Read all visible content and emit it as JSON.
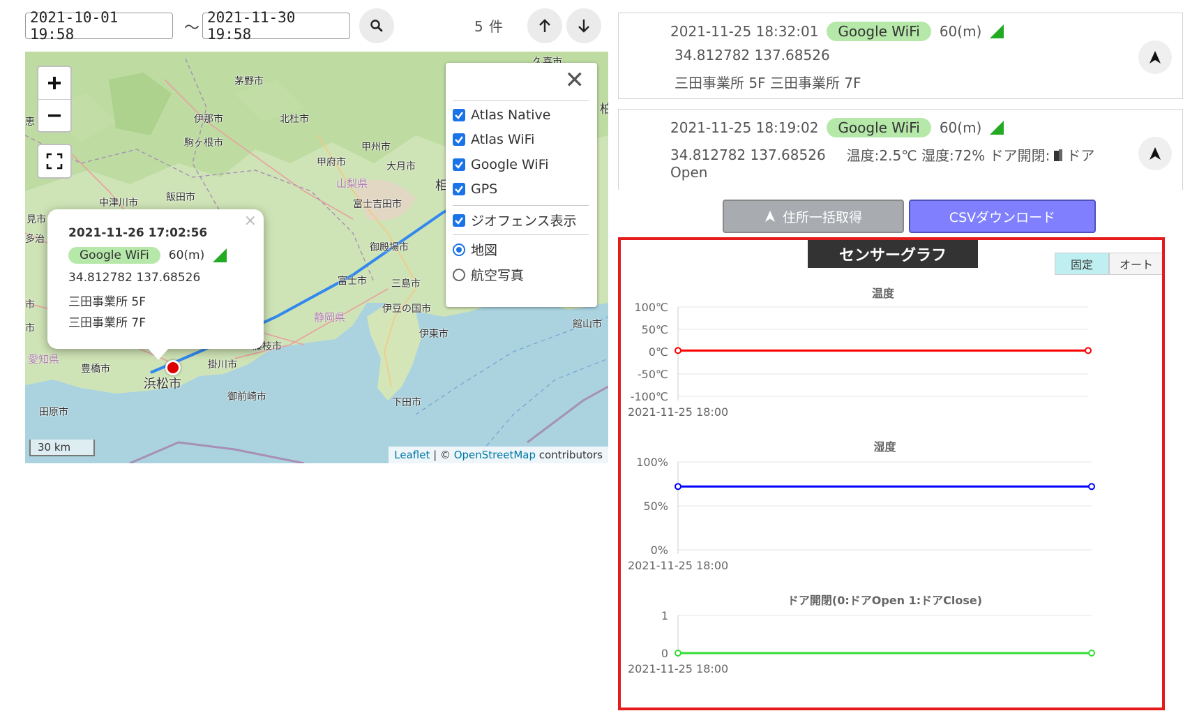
{
  "toolbar": {
    "date_from": "2021-10-01 19:58",
    "date_to": "2021-11-30 19:58",
    "separator": "〜",
    "count": "5 件"
  },
  "map": {
    "towns": [
      "茅野市",
      "伊那市",
      "北杜市",
      "駒ヶ根市",
      "甲州市",
      "甲府市",
      "大月市",
      "飯田市",
      "中津川市",
      "富士吉田市",
      "御殿場市",
      "富士市",
      "三島市",
      "伊豆の国市",
      "静岡県",
      "伊東市",
      "館山市",
      "藤枝市",
      "掛川市",
      "豊橋市",
      "浜松市",
      "御前崎市",
      "下田市",
      "田原市",
      "愛知県",
      "山梨県",
      "相",
      "柏",
      "見市",
      "多治",
      "市",
      "市",
      "恵",
      "久喜市"
    ],
    "scale_label": "30 km",
    "attribution": {
      "leaflet": "Leaflet",
      "sep": " | © ",
      "osm": "OpenStreetMap",
      "tail": " contributors"
    },
    "layers": {
      "items": [
        {
          "label": "Atlas Native",
          "checked": true
        },
        {
          "label": "Atlas WiFi",
          "checked": true
        },
        {
          "label": "Google WiFi",
          "checked": true
        },
        {
          "label": "GPS",
          "checked": true
        },
        {
          "label": "ジオフェンス表示",
          "checked": true
        }
      ],
      "bases": [
        {
          "label": "地図",
          "selected": true
        },
        {
          "label": "航空写真",
          "selected": false
        }
      ]
    },
    "popup": {
      "datetime": "2021-11-26 17:02:56",
      "source": "Google WiFi",
      "accuracy": "60(m)",
      "coords": "34.812782 137.68526",
      "line1": "三田事業所 5F",
      "line2": "三田事業所 7F",
      "close": "×"
    }
  },
  "records": [
    {
      "datetime": "2021-11-25 18:32:01",
      "source": "Google WiFi",
      "accuracy": "60(m)",
      "coords": "34.812782 137.68526",
      "info": "三田事業所 5F 三田事業所 7F"
    },
    {
      "datetime": "2021-11-25 18:19:02",
      "source": "Google WiFi",
      "accuracy": "60(m)",
      "coords": "34.812782 137.68526",
      "info": "温度:2.5℃ 湿度:72% ドア開閉:",
      "info_tail": "ドア",
      "info2": "Open"
    }
  ],
  "actions": {
    "address_bulk": "住所一括取得",
    "csv_download": "CSVダウンロード"
  },
  "graph": {
    "title": "センサーグラフ",
    "toggle_fixed": "固定",
    "toggle_auto": "オート"
  },
  "colors": {
    "pill": "#b5e8a9",
    "signal": "#22aa22",
    "highlight_border": "#e51a1a",
    "csv_button": "#8080ff",
    "address_button": "#a8abb0"
  },
  "chart_data": [
    {
      "type": "line",
      "title": "温度",
      "x": [
        "2021-11-25 18:00"
      ],
      "y_ticks": [
        "100℃",
        "50℃",
        "0℃",
        "-50℃",
        "-100℃"
      ],
      "ylim": [
        -100,
        100
      ],
      "series": [
        {
          "values": [
            2.5,
            2.5
          ],
          "color": "#ff0000"
        }
      ]
    },
    {
      "type": "line",
      "title": "湿度",
      "x": [
        "2021-11-25 18:00"
      ],
      "y_ticks": [
        "100%",
        "50%",
        "0%"
      ],
      "ylim": [
        0,
        100
      ],
      "series": [
        {
          "values": [
            72,
            72
          ],
          "color": "#0000ff"
        }
      ]
    },
    {
      "type": "line",
      "title": "ドア開閉(0:ドアOpen 1:ドアClose)",
      "x": [
        "2021-11-25 18:00"
      ],
      "y_ticks": [
        "1",
        "0"
      ],
      "ylim": [
        0,
        1
      ],
      "series": [
        {
          "values": [
            0,
            0
          ],
          "color": "#33dd33"
        }
      ]
    }
  ]
}
